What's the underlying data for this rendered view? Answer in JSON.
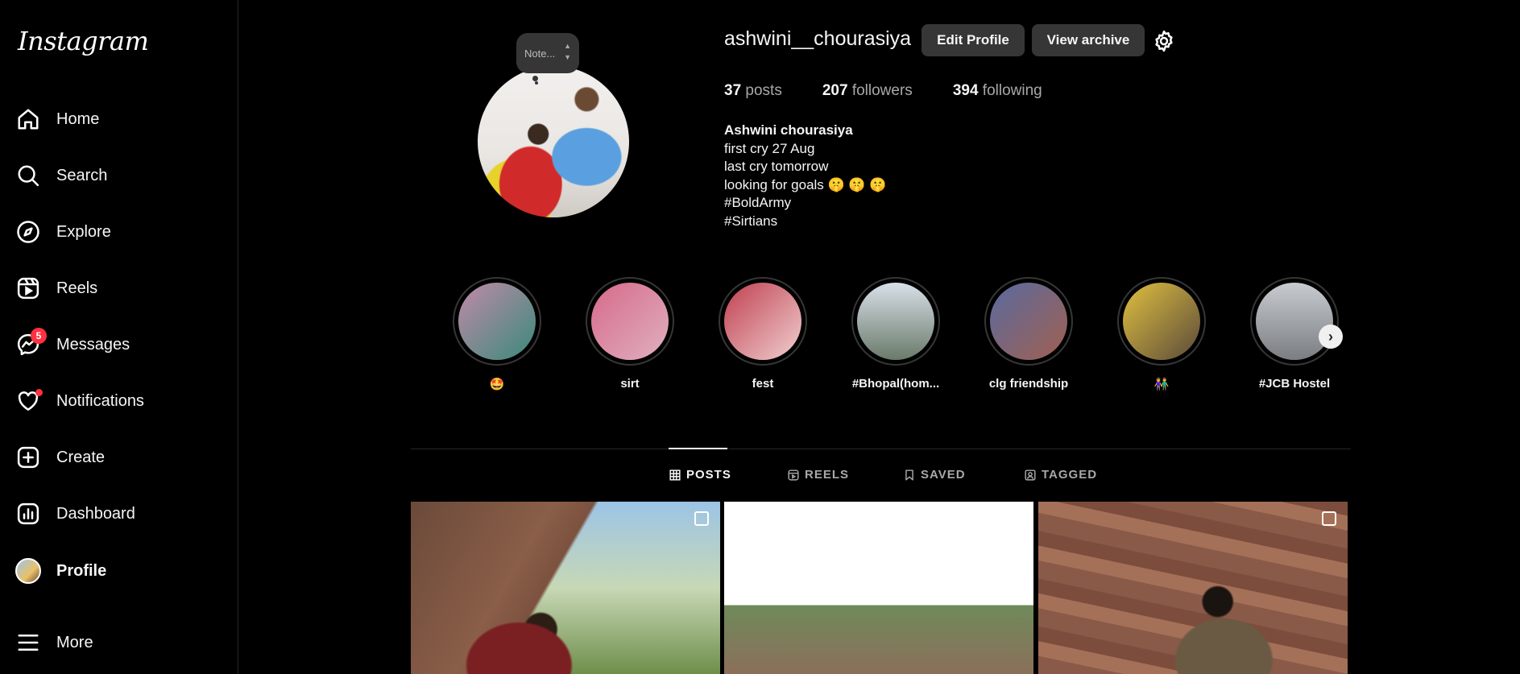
{
  "app": {
    "logo": "Instagram"
  },
  "sidebar": {
    "items": [
      {
        "label": "Home",
        "icon": "home-icon"
      },
      {
        "label": "Search",
        "icon": "search-icon"
      },
      {
        "label": "Explore",
        "icon": "explore-icon"
      },
      {
        "label": "Reels",
        "icon": "reels-icon"
      },
      {
        "label": "Messages",
        "icon": "messenger-icon",
        "badge": "5"
      },
      {
        "label": "Notifications",
        "icon": "heart-icon"
      },
      {
        "label": "Create",
        "icon": "plus-square-icon"
      },
      {
        "label": "Dashboard",
        "icon": "dashboard-icon"
      },
      {
        "label": "Profile",
        "icon": "avatar"
      }
    ],
    "more": {
      "label": "More",
      "icon": "menu-icon"
    }
  },
  "profile": {
    "note": "Note...",
    "username": "ashwini__chourasiya",
    "edit_label": "Edit Profile",
    "archive_label": "View archive",
    "stats": {
      "posts_count": "37",
      "posts_label": "posts",
      "followers_count": "207",
      "followers_label": "followers",
      "following_count": "394",
      "following_label": "following"
    },
    "bio": {
      "name": "Ashwini chourasiya",
      "lines": [
        "first cry 27 Aug",
        "last cry tomorrow",
        "looking for goals 🤫 🤫 🤫",
        "#BoldArmy",
        "#Sirtians"
      ]
    }
  },
  "highlights": [
    {
      "label": "🤩",
      "colors": [
        "#c08aa8",
        "#3a8a7a"
      ]
    },
    {
      "label": "sirt",
      "colors": [
        "#d66a8a",
        "#e0b0c0"
      ]
    },
    {
      "label": "fest",
      "colors": [
        "#c04050",
        "#f0d0d0"
      ]
    },
    {
      "label": "#Bhopal(hom...",
      "colors": [
        "#d8e0e8",
        "#6a7a6a"
      ]
    },
    {
      "label": "clg friendship",
      "colors": [
        "#5a6aa0",
        "#a06050"
      ]
    },
    {
      "label": "👫",
      "colors": [
        "#e0c040",
        "#5a4a3a"
      ]
    },
    {
      "label": "#JCB Hostel",
      "colors": [
        "#c8ccd0",
        "#7a7e82"
      ]
    }
  ],
  "tabs": [
    {
      "label": "POSTS",
      "active": true,
      "icon": "grid-icon"
    },
    {
      "label": "REELS",
      "active": false,
      "icon": "reels-icon"
    },
    {
      "label": "SAVED",
      "active": false,
      "icon": "bookmark-icon"
    },
    {
      "label": "TAGGED",
      "active": false,
      "icon": "tagged-icon"
    }
  ]
}
